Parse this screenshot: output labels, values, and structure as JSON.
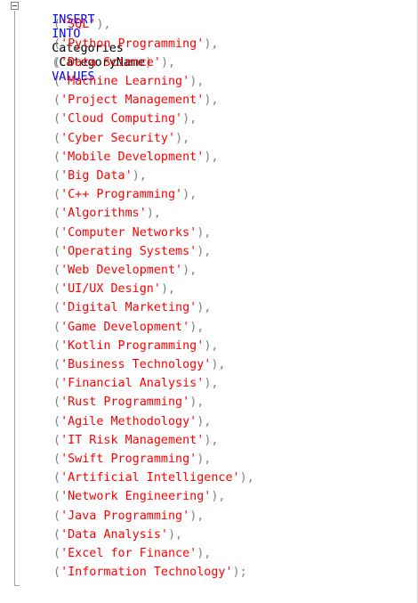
{
  "editor": {
    "statement": {
      "insert_kw": "INSERT",
      "into_kw": "INTO",
      "table": "Categories",
      "open_paren": "(",
      "column": "CategoryName",
      "close_paren": ")",
      "values_kw": "VALUES"
    },
    "rows": [
      {
        "open": "(",
        "value": "'SQL'",
        "close": "),"
      },
      {
        "open": "(",
        "value": "'Python Programming'",
        "close": "),"
      },
      {
        "open": "(",
        "value": "'Data Science'",
        "close": "),"
      },
      {
        "open": "(",
        "value": "'Machine Learning'",
        "close": "),"
      },
      {
        "open": "(",
        "value": "'Project Management'",
        "close": "),"
      },
      {
        "open": "(",
        "value": "'Cloud Computing'",
        "close": "),"
      },
      {
        "open": "(",
        "value": "'Cyber Security'",
        "close": "),"
      },
      {
        "open": "(",
        "value": "'Mobile Development'",
        "close": "),"
      },
      {
        "open": "(",
        "value": "'Big Data'",
        "close": "),"
      },
      {
        "open": "(",
        "value": "'C++ Programming'",
        "close": "),"
      },
      {
        "open": "(",
        "value": "'Algorithms'",
        "close": "),"
      },
      {
        "open": "(",
        "value": "'Computer Networks'",
        "close": "),"
      },
      {
        "open": "(",
        "value": "'Operating Systems'",
        "close": "),"
      },
      {
        "open": "(",
        "value": "'Web Development'",
        "close": "),"
      },
      {
        "open": "(",
        "value": "'UI/UX Design'",
        "close": "),"
      },
      {
        "open": "(",
        "value": "'Digital Marketing'",
        "close": "),"
      },
      {
        "open": "(",
        "value": "'Game Development'",
        "close": "),"
      },
      {
        "open": "(",
        "value": "'Kotlin Programming'",
        "close": "),"
      },
      {
        "open": "(",
        "value": "'Business Technology'",
        "close": "),"
      },
      {
        "open": "(",
        "value": "'Financial Analysis'",
        "close": "),"
      },
      {
        "open": "(",
        "value": "'Rust Programming'",
        "close": "),"
      },
      {
        "open": "(",
        "value": "'Agile Methodology'",
        "close": "),"
      },
      {
        "open": "(",
        "value": "'IT Risk Management'",
        "close": "),"
      },
      {
        "open": "(",
        "value": "'Swift Programming'",
        "close": "),"
      },
      {
        "open": "(",
        "value": "'Artificial Intelligence'",
        "close": "),"
      },
      {
        "open": "(",
        "value": "'Network Engineering'",
        "close": "),"
      },
      {
        "open": "(",
        "value": "'Java Programming'",
        "close": "),"
      },
      {
        "open": "(",
        "value": "'Data Analysis'",
        "close": "),"
      },
      {
        "open": "(",
        "value": "'Excel for Finance'",
        "close": "),"
      },
      {
        "open": "(",
        "value": "'Information Technology'",
        "close": ");"
      }
    ],
    "colors": {
      "keyword": "#0000ff",
      "identifier": "#000000",
      "punctuation": "#808080",
      "string": "#ff0000"
    },
    "icons": {
      "outline_toggle": "collapse-minus-icon"
    }
  }
}
